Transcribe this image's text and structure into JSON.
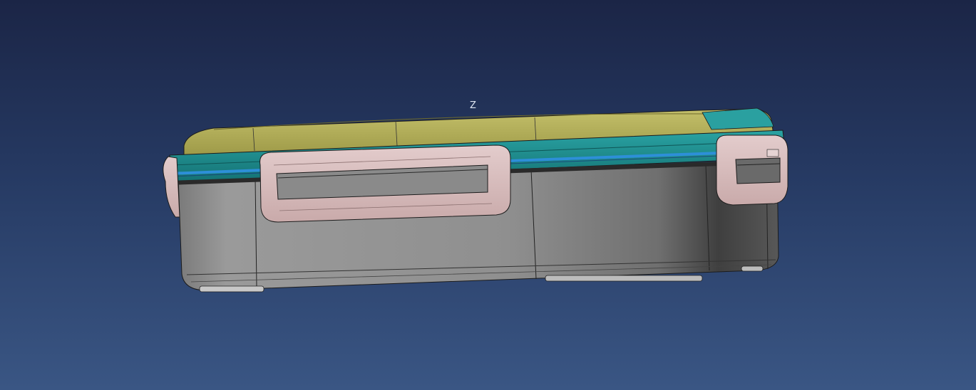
{
  "viewport": {
    "axis_label": "Z",
    "background_top": "#1b2546",
    "background_bottom": "#3a5684"
  },
  "model": {
    "colors": {
      "body": "#8e8e8e",
      "lid_yellow": "#b6b25b",
      "lid_teal": "#1f8a8c",
      "seal_blue": "#2d8fd8",
      "clips": "#d7bcbc",
      "edges": "#1c1c1c"
    }
  }
}
